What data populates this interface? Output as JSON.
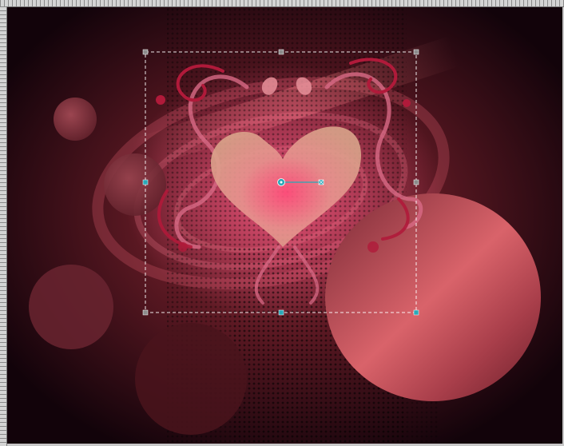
{
  "window": {
    "mode": "pick-tool-transform"
  },
  "colors": {
    "background_dark": "#1a0508",
    "wine": "#6b1e2a",
    "rose": "#c24a5a",
    "heart": "#e59a96",
    "swirl_pink": "#d86a86",
    "swirl_red": "#b01a3a",
    "selection_line": "#ffffff",
    "handle_gray": "#8c8c8c",
    "handle_cyan": "#2aa9b8"
  },
  "icons": {
    "rotation_pivot": "pivot-circle-icon",
    "rotation_handle": "rotate-handle-icon"
  }
}
